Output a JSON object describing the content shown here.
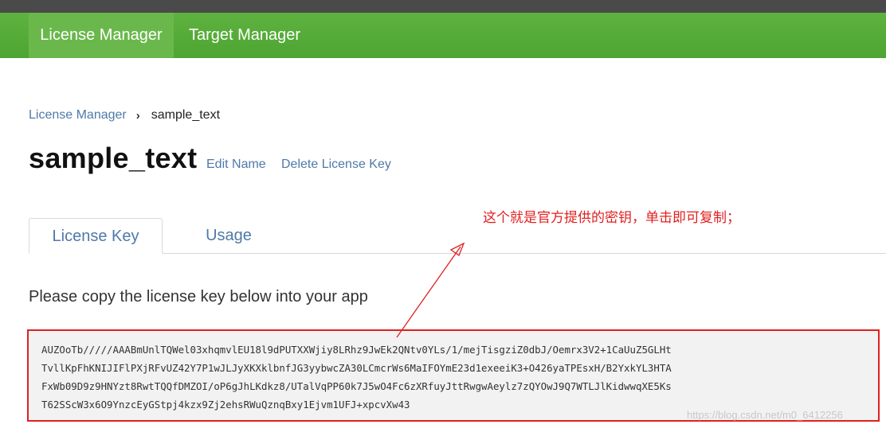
{
  "nav": {
    "items": [
      {
        "label": "License Manager",
        "active": true
      },
      {
        "label": "Target Manager",
        "active": false
      }
    ]
  },
  "breadcrumb": {
    "parent": "License Manager",
    "separator": "›",
    "current": "sample_text"
  },
  "page": {
    "title": "sample_text",
    "edit_name": "Edit Name",
    "delete_key": "Delete License Key"
  },
  "tabs": [
    {
      "label": "License Key",
      "active": true
    },
    {
      "label": "Usage",
      "active": false
    }
  ],
  "instruction": "Please copy the license key below into your app",
  "license_key": {
    "lines": [
      "AUZOoTb/////AAABmUnlTQWel03xhqmvlEU18l9dPUTXXWjiy8LRhz9JwEk2QNtv0YLs/1/mejTisgziZ0dbJ/Oemrx3V2+1CaUuZ5GLHt",
      "TvllKpFhKNIJIFlPXjRFvUZ42Y7P1wJLJyXKXklbnfJG3yybwcZA30LCmcrWs6MaIFOYmE23d1exeeiK3+O426yaTPEsxH/B2YxkYL3HTA",
      "FxWb09D9z9HNYzt8RwtTQQfDMZOI/oP6gJhLKdkz8/UTalVqPP60k7J5wO4Fc6zXRfuyJttRwgwAeylz7zQYOwJ9Q7WTLJlKidwwqXE5Ks",
      "T62SScW3x6O9YnzcEyGStpj4kzx9Zj2ehsRWuQznqBxy1Ejvm1UFJ+xpcvXw43"
    ]
  },
  "annotation": {
    "text": "这个就是官方提供的密钥，单击即可复制；"
  },
  "watermark": "https://blog.csdn.net/m0_6412256",
  "colors": {
    "nav_green": "#4da532",
    "link_blue": "#4f79a8",
    "annotation_red": "#e02020"
  }
}
